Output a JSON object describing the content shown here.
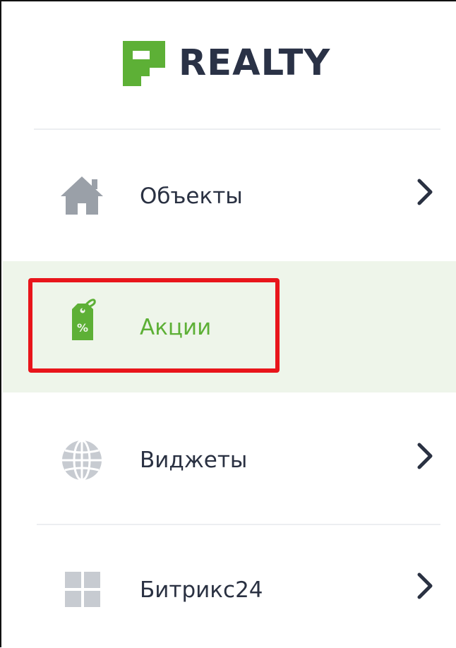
{
  "brand": {
    "name": "REALTY",
    "accent": "#5db036",
    "text_color": "#2a3246"
  },
  "nav": {
    "items": [
      {
        "label": "Объекты",
        "icon": "home-icon",
        "has_children": true,
        "active": false
      },
      {
        "label": "Акции",
        "icon": "price-tag-percent-icon",
        "has_children": false,
        "active": true
      },
      {
        "label": "Виджеты",
        "icon": "globe-icon",
        "has_children": true,
        "active": false
      },
      {
        "label": "Битрикс24",
        "icon": "grid-icon",
        "has_children": true,
        "active": false
      }
    ]
  },
  "highlight": {
    "target": "Акции",
    "color": "#e8151b"
  }
}
